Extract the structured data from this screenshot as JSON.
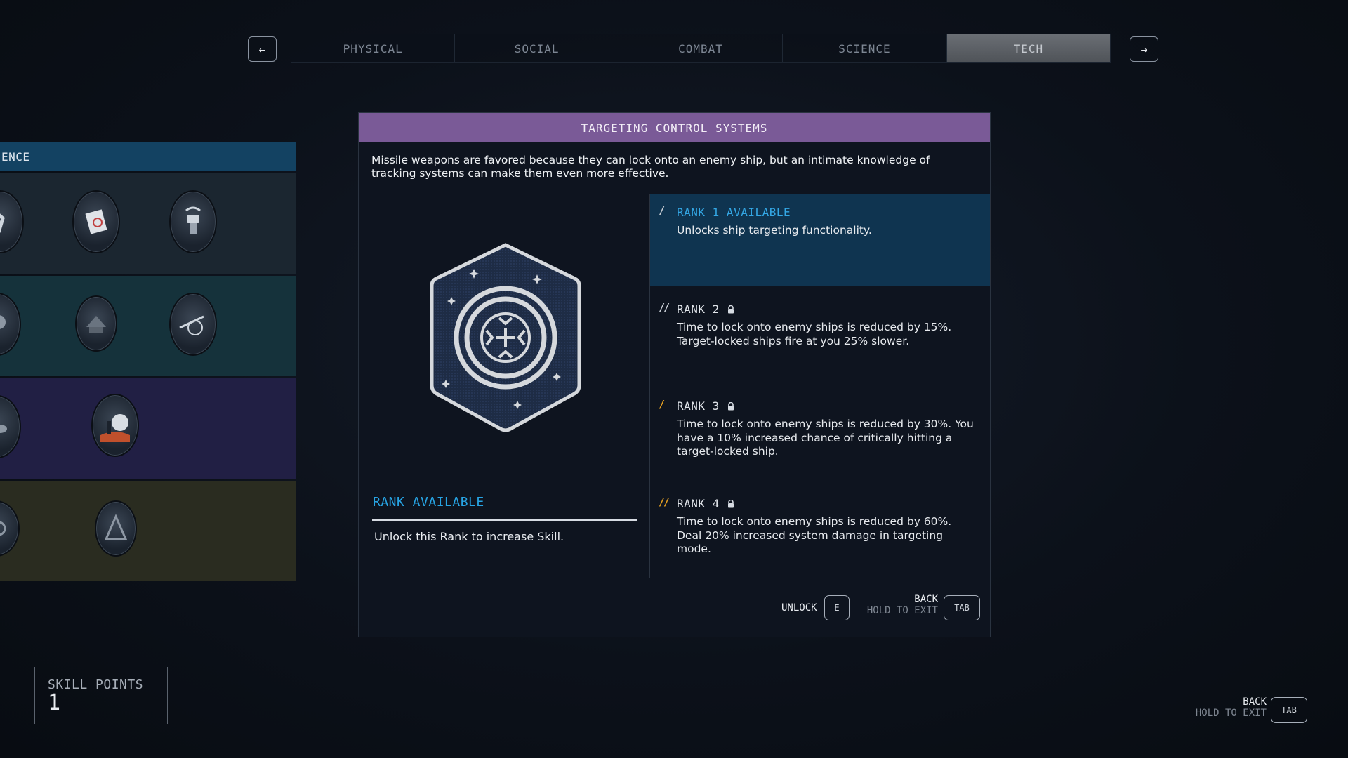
{
  "nav": {
    "prev_icon": "arrow-left-icon",
    "next_icon": "arrow-right-icon",
    "prev_glyph": "←",
    "next_glyph": "→",
    "tabs": [
      {
        "label": "PHYSICAL"
      },
      {
        "label": "SOCIAL"
      },
      {
        "label": "COMBAT"
      },
      {
        "label": "SCIENCE"
      },
      {
        "label": "TECH"
      }
    ],
    "active_tab": "TECH"
  },
  "tree": {
    "header": "ENCE",
    "colors": {
      "header": "#134262",
      "row_1": "#1b2630",
      "row_2": "#15323b",
      "row_3": "#211f44",
      "row_4": "#2a2c20"
    }
  },
  "modal": {
    "title": "TARGETING CONTROL SYSTEMS",
    "title_color": "#7a5a97",
    "description": "Missile weapons are favored because they can lock onto an enemy ship, but an intimate knowledge of tracking systems can make them even more effective.",
    "badge_icon": "targeting-reticle-badge-icon",
    "status_title": "RANK AVAILABLE",
    "status_desc": "Unlock this Rank to increase Skill.",
    "ranks": [
      {
        "label": "RANK 1 AVAILABLE",
        "desc": "Unlocks ship targeting functionality.",
        "locked": false,
        "marker_color": "#c9ced5"
      },
      {
        "label": "RANK 2",
        "desc": "Time to lock onto enemy ships is reduced by 15%. Target-locked ships fire at you 25% slower.",
        "locked": true,
        "marker_color": "#c9ced5"
      },
      {
        "label": "RANK 3",
        "desc": "Time to lock onto enemy ships is reduced by 30%. You have a 10% increased chance of critically hitting a target-locked ship.",
        "locked": true,
        "marker_color": "#e6a020"
      },
      {
        "label": "RANK 4",
        "desc": "Time to lock onto enemy ships is reduced by 60%. Deal 20% increased system damage in targeting mode.",
        "locked": true,
        "marker_color": "#e6a020"
      }
    ],
    "footer": {
      "unlock_label": "UNLOCK",
      "unlock_key": "E",
      "back_label": "BACK",
      "hold_label": "HOLD TO EXIT",
      "back_key": "TAB"
    }
  },
  "skill_points": {
    "label": "SKILL POINTS",
    "value": "1"
  },
  "corner": {
    "back_label": "BACK",
    "hold_label": "HOLD TO EXIT",
    "key": "TAB"
  }
}
